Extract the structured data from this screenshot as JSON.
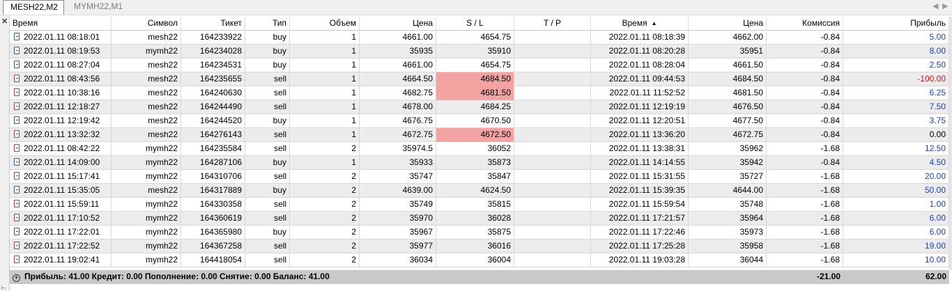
{
  "tabs": [
    {
      "label": "MESH22,M2",
      "active": true
    },
    {
      "label": "MYMH22,M1",
      "active": false
    }
  ],
  "columns": [
    "Время",
    "Символ",
    "Тикет",
    "Тип",
    "Объем",
    "Цена",
    "S / L",
    "T / P",
    "Время",
    "Цена",
    "Комиссия",
    "Прибыль"
  ],
  "sort_indicator": "▲",
  "left_bar_label": "Т",
  "rows": [
    {
      "open_time": "2022.01.11 08:18:01",
      "symbol": "mesh22",
      "ticket": "164233922",
      "type": "buy",
      "volume": "1",
      "open_price": "4661.00",
      "sl": "4654.75",
      "tp": "",
      "close_time": "2022.01.11 08:18:39",
      "close_price": "4662.00",
      "commission": "-0.84",
      "profit": "5.00"
    },
    {
      "open_time": "2022.01.11 08:19:53",
      "symbol": "mymh22",
      "ticket": "164234028",
      "type": "buy",
      "volume": "1",
      "open_price": "35935",
      "sl": "35910",
      "tp": "",
      "close_time": "2022.01.11 08:20:28",
      "close_price": "35951",
      "commission": "-0.84",
      "profit": "8.00"
    },
    {
      "open_time": "2022.01.11 08:27:04",
      "symbol": "mesh22",
      "ticket": "164234531",
      "type": "buy",
      "volume": "1",
      "open_price": "4661.00",
      "sl": "4654.75",
      "tp": "",
      "close_time": "2022.01.11 08:28:04",
      "close_price": "4661.50",
      "commission": "-0.84",
      "profit": "2.50"
    },
    {
      "open_time": "2022.01.11 08:43:56",
      "symbol": "mesh22",
      "ticket": "164235655",
      "type": "sell",
      "volume": "1",
      "open_price": "4664.50",
      "sl": "4684.50",
      "tp": "",
      "close_time": "2022.01.11 09:44:53",
      "close_price": "4684.50",
      "commission": "-0.84",
      "profit": "-100.00",
      "sl_hit": true
    },
    {
      "open_time": "2022.01.11 10:38:16",
      "symbol": "mesh22",
      "ticket": "164240630",
      "type": "sell",
      "volume": "1",
      "open_price": "4682.75",
      "sl": "4681.50",
      "tp": "",
      "close_time": "2022.01.11 11:52:52",
      "close_price": "4681.50",
      "commission": "-0.84",
      "profit": "6.25",
      "sl_hit": true
    },
    {
      "open_time": "2022.01.11 12:18:27",
      "symbol": "mesh22",
      "ticket": "164244490",
      "type": "sell",
      "volume": "1",
      "open_price": "4678.00",
      "sl": "4684.25",
      "tp": "",
      "close_time": "2022.01.11 12:19:19",
      "close_price": "4676.50",
      "commission": "-0.84",
      "profit": "7.50"
    },
    {
      "open_time": "2022.01.11 12:19:42",
      "symbol": "mesh22",
      "ticket": "164244520",
      "type": "buy",
      "volume": "1",
      "open_price": "4676.75",
      "sl": "4670.50",
      "tp": "",
      "close_time": "2022.01.11 12:20:51",
      "close_price": "4677.50",
      "commission": "-0.84",
      "profit": "3.75"
    },
    {
      "open_time": "2022.01.11 13:32:32",
      "symbol": "mesh22",
      "ticket": "164276143",
      "type": "sell",
      "volume": "1",
      "open_price": "4672.75",
      "sl": "4672.50",
      "tp": "",
      "close_time": "2022.01.11 13:36:20",
      "close_price": "4672.75",
      "commission": "-0.84",
      "profit": "0.00",
      "sl_hit": true
    },
    {
      "open_time": "2022.01.11 08:42:22",
      "symbol": "mymh22",
      "ticket": "164235584",
      "type": "sell",
      "volume": "2",
      "open_price": "35974.5",
      "sl": "36052",
      "tp": "",
      "close_time": "2022.01.11 13:38:31",
      "close_price": "35962",
      "commission": "-1.68",
      "profit": "12.50"
    },
    {
      "open_time": "2022.01.11 14:09:00",
      "symbol": "mymh22",
      "ticket": "164287106",
      "type": "buy",
      "volume": "1",
      "open_price": "35933",
      "sl": "35873",
      "tp": "",
      "close_time": "2022.01.11 14:14:55",
      "close_price": "35942",
      "commission": "-0.84",
      "profit": "4.50"
    },
    {
      "open_time": "2022.01.11 15:17:41",
      "symbol": "mymh22",
      "ticket": "164310706",
      "type": "sell",
      "volume": "2",
      "open_price": "35747",
      "sl": "35847",
      "tp": "",
      "close_time": "2022.01.11 15:31:55",
      "close_price": "35727",
      "commission": "-1.68",
      "profit": "20.00"
    },
    {
      "open_time": "2022.01.11 15:35:05",
      "symbol": "mesh22",
      "ticket": "164317889",
      "type": "buy",
      "volume": "2",
      "open_price": "4639.00",
      "sl": "4624.50",
      "tp": "",
      "close_time": "2022.01.11 15:39:35",
      "close_price": "4644.00",
      "commission": "-1.68",
      "profit": "50.00"
    },
    {
      "open_time": "2022.01.11 15:59:11",
      "symbol": "mymh22",
      "ticket": "164330358",
      "type": "sell",
      "volume": "2",
      "open_price": "35749",
      "sl": "35815",
      "tp": "",
      "close_time": "2022.01.11 15:59:54",
      "close_price": "35748",
      "commission": "-1.68",
      "profit": "1.00"
    },
    {
      "open_time": "2022.01.11 17:10:52",
      "symbol": "mymh22",
      "ticket": "164360619",
      "type": "sell",
      "volume": "2",
      "open_price": "35970",
      "sl": "36028",
      "tp": "",
      "close_time": "2022.01.11 17:21:57",
      "close_price": "35964",
      "commission": "-1.68",
      "profit": "6.00"
    },
    {
      "open_time": "2022.01.11 17:22:01",
      "symbol": "mymh22",
      "ticket": "164365980",
      "type": "buy",
      "volume": "2",
      "open_price": "35967",
      "sl": "35875",
      "tp": "",
      "close_time": "2022.01.11 17:22:46",
      "close_price": "35973",
      "commission": "-1.68",
      "profit": "6.00"
    },
    {
      "open_time": "2022.01.11 17:22:52",
      "symbol": "mymh22",
      "ticket": "164367258",
      "type": "sell",
      "volume": "2",
      "open_price": "35977",
      "sl": "36016",
      "tp": "",
      "close_time": "2022.01.11 17:25:28",
      "close_price": "35958",
      "commission": "-1.68",
      "profit": "19.00"
    },
    {
      "open_time": "2022.01.11 19:02:41",
      "symbol": "mymh22",
      "ticket": "164418054",
      "type": "sell",
      "volume": "2",
      "open_price": "36034",
      "sl": "36004",
      "tp": "",
      "close_time": "2022.01.11 19:03:28",
      "close_price": "36044",
      "commission": "-1.68",
      "profit": "10.00"
    }
  ],
  "summary": {
    "text": "Прибыль: 41.00  Кредит: 0.00  Пополнение: 0.00  Снятие: 0.00  Баланс: 41.00",
    "commission_total": "-21.00",
    "profit_total": "62.00"
  },
  "colors": {
    "profit_positive": "#1f3fbf",
    "profit_negative": "#d01414",
    "sl_hit_highlight": "#f4a3a3",
    "summary_bg": "#c9c9c9"
  }
}
